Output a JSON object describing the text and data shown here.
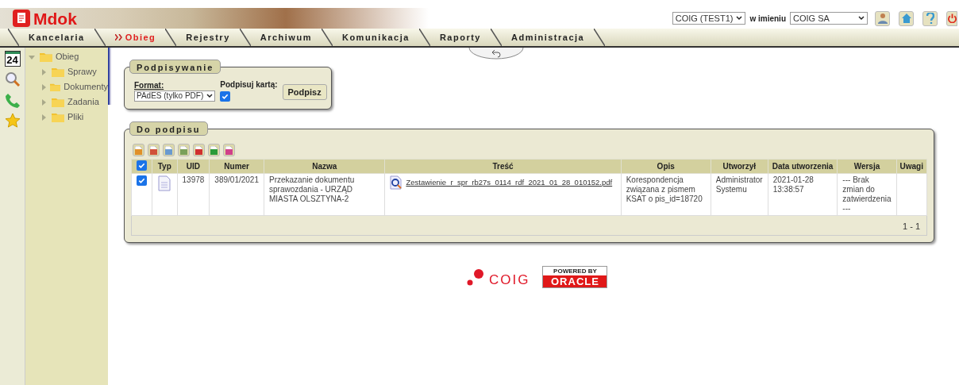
{
  "header": {
    "logo": "Mdok",
    "account_select": "COIG (TEST1)",
    "on_behalf_label": "w imieniu",
    "on_behalf_select": "COIG SA"
  },
  "tabs": [
    {
      "label": "Kancelaria",
      "selected": false
    },
    {
      "label": "Obieg",
      "selected": true
    },
    {
      "label": "Rejestry",
      "selected": false
    },
    {
      "label": "Archiwum",
      "selected": false
    },
    {
      "label": "Komunikacja",
      "selected": false
    },
    {
      "label": "Raporty",
      "selected": false
    },
    {
      "label": "Administracja",
      "selected": false
    }
  ],
  "side_icons": [
    {
      "kind": "calendar",
      "text": "24"
    },
    {
      "kind": "search"
    },
    {
      "kind": "phone"
    },
    {
      "kind": "star"
    }
  ],
  "tree": [
    {
      "label": "Obieg",
      "expanded": true,
      "children": [
        {
          "label": "Sprawy",
          "expanded": false
        },
        {
          "label": "Dokumenty",
          "expanded": false
        },
        {
          "label": "Zadania",
          "expanded": false
        },
        {
          "label": "Pliki",
          "expanded": false
        }
      ]
    }
  ],
  "signing": {
    "title": "Podpisywanie",
    "format_label": "Format:",
    "format_value": "PAdES (tylko PDF)",
    "card_label": "Podpisuj kartą:",
    "card_checked": true,
    "button": "Podpisz"
  },
  "to_sign": {
    "title": "Do podpisu",
    "export_buttons": [
      {
        "color": "#e0902a"
      },
      {
        "color": "#d0503a"
      },
      {
        "color": "#6a9ad0"
      },
      {
        "color": "#7aa05a"
      },
      {
        "color": "#d03030"
      },
      {
        "color": "#2a9a3a"
      },
      {
        "color": "#d0408a"
      }
    ],
    "select_all": true,
    "columns": [
      "Typ",
      "UID",
      "Numer",
      "Nazwa",
      "Treść",
      "Opis",
      "Utworzył",
      "Data utworzenia",
      "Wersja",
      "Uwagi"
    ],
    "rows": [
      {
        "selected": true,
        "uid": "13978",
        "number": "389/01/2021",
        "name": "Przekazanie dokumentu sprawozdania - URZĄD MIASTA OLSZTYNA-2",
        "file": "Zestawienie_r_spr_rb27s_0114_rdf_2021_01_28_010152.pdf",
        "description": "Korespondencja związana z pismem KSAT o pis_id=18720",
        "created_by": "Administrator Systemu",
        "created": "2021-01-28 13:38:57",
        "version": "--- Brak zmian do zatwierdzenia ---"
      }
    ],
    "pager": "1 - 1"
  },
  "footer": {
    "coig": "COIG",
    "powered": "POWERED BY",
    "oracle": "ORACLE"
  }
}
